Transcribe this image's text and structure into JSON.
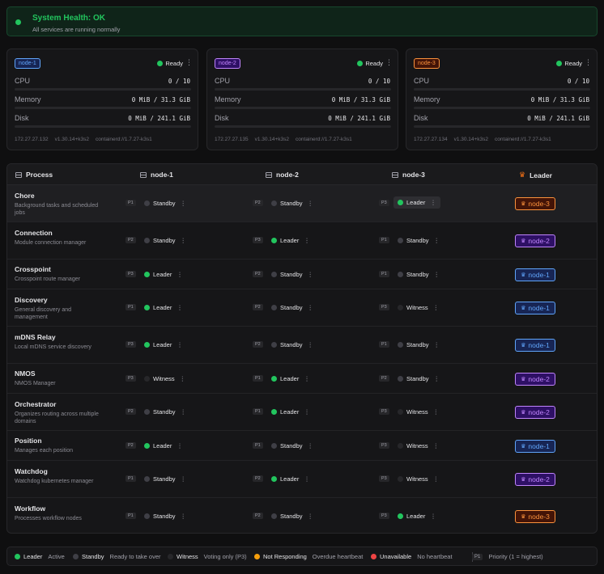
{
  "health": {
    "title": "System Health: OK",
    "subtitle": "All services are running normally"
  },
  "nodes": [
    {
      "name": "node-1",
      "status": "Ready",
      "cpu_label": "CPU",
      "cpu": "0 / 10",
      "mem_label": "Memory",
      "mem": "0 MiB / 31.3 GiB",
      "disk_label": "Disk",
      "disk": "0 MiB / 241.1 GiB",
      "ip": "172.27.27.132",
      "version": "v1.30.14+k3s2",
      "runtime": "containerd://1.7.27-k3s1",
      "color": "#60a5fa"
    },
    {
      "name": "node-2",
      "status": "Ready",
      "cpu_label": "CPU",
      "cpu": "0 / 10",
      "mem_label": "Memory",
      "mem": "0 MiB / 31.3 GiB",
      "disk_label": "Disk",
      "disk": "0 MiB / 241.1 GiB",
      "ip": "172.27.27.135",
      "version": "v1.30.14+k3s2",
      "runtime": "containerd://1.7.27-k3s1",
      "color": "#c084fc"
    },
    {
      "name": "node-3",
      "status": "Ready",
      "cpu_label": "CPU",
      "cpu": "0 / 10",
      "mem_label": "Memory",
      "mem": "0 MiB / 31.3 GiB",
      "disk_label": "Disk",
      "disk": "0 MiB / 241.1 GiB",
      "ip": "172.27.27.134",
      "version": "v1.30.14+k3s2",
      "runtime": "containerd://1.7.27-k3s1",
      "color": "#fb923c"
    }
  ],
  "table": {
    "headers": {
      "process": "Process",
      "node1": "node-1",
      "node2": "node-2",
      "node3": "node-3",
      "leader": "Leader"
    },
    "rows": [
      {
        "name": "Chore",
        "desc": "Background tasks and scheduled jobs",
        "cells": [
          {
            "p": "P1",
            "role": "Standby"
          },
          {
            "p": "P2",
            "role": "Standby"
          },
          {
            "p": "P3",
            "role": "Leader"
          }
        ],
        "leader": "node-3"
      },
      {
        "name": "Connection",
        "desc": "Module connection manager",
        "cells": [
          {
            "p": "P2",
            "role": "Standby"
          },
          {
            "p": "P3",
            "role": "Leader"
          },
          {
            "p": "P1",
            "role": "Standby"
          }
        ],
        "leader": "node-2"
      },
      {
        "name": "Crosspoint",
        "desc": "Crosspoint route manager",
        "cells": [
          {
            "p": "P3",
            "role": "Leader"
          },
          {
            "p": "P2",
            "role": "Standby"
          },
          {
            "p": "P1",
            "role": "Standby"
          }
        ],
        "leader": "node-1"
      },
      {
        "name": "Discovery",
        "desc": "General discovery and management",
        "cells": [
          {
            "p": "P1",
            "role": "Leader"
          },
          {
            "p": "P2",
            "role": "Standby"
          },
          {
            "p": "P3",
            "role": "Witness"
          }
        ],
        "leader": "node-1"
      },
      {
        "name": "mDNS Relay",
        "desc": "Local mDNS service discovery",
        "cells": [
          {
            "p": "P3",
            "role": "Leader"
          },
          {
            "p": "P2",
            "role": "Standby"
          },
          {
            "p": "P1",
            "role": "Standby"
          }
        ],
        "leader": "node-1"
      },
      {
        "name": "NMOS",
        "desc": "NMOS Manager",
        "cells": [
          {
            "p": "P3",
            "role": "Witness"
          },
          {
            "p": "P1",
            "role": "Leader"
          },
          {
            "p": "P2",
            "role": "Standby"
          }
        ],
        "leader": "node-2"
      },
      {
        "name": "Orchestrator",
        "desc": "Organizes routing across multiple domains",
        "cells": [
          {
            "p": "P2",
            "role": "Standby"
          },
          {
            "p": "P1",
            "role": "Leader"
          },
          {
            "p": "P3",
            "role": "Witness"
          }
        ],
        "leader": "node-2"
      },
      {
        "name": "Position",
        "desc": "Manages each position",
        "cells": [
          {
            "p": "P2",
            "role": "Leader"
          },
          {
            "p": "P1",
            "role": "Standby"
          },
          {
            "p": "P3",
            "role": "Witness"
          }
        ],
        "leader": "node-1"
      },
      {
        "name": "Watchdog",
        "desc": "Watchdog kubernetes manager",
        "cells": [
          {
            "p": "P1",
            "role": "Standby"
          },
          {
            "p": "P2",
            "role": "Leader"
          },
          {
            "p": "P3",
            "role": "Witness"
          }
        ],
        "leader": "node-2"
      },
      {
        "name": "Workflow",
        "desc": "Processes workflow nodes",
        "cells": [
          {
            "p": "P1",
            "role": "Standby"
          },
          {
            "p": "P2",
            "role": "Standby"
          },
          {
            "p": "P3",
            "role": "Leader"
          }
        ],
        "leader": "node-3"
      }
    ]
  },
  "legend": {
    "leader": "Leader",
    "leader_desc": "Active",
    "standby": "Standby",
    "standby_desc": "Ready to take over",
    "witness": "Witness",
    "witness_desc": "Voting only (P3)",
    "notresp": "Not Responding",
    "notresp_desc": "Overdue heartbeat",
    "unavail": "Unavailable",
    "unavail_desc": "No heartbeat",
    "prio_badge": "P1",
    "prio_desc": "Priority (1 = highest)"
  },
  "colors": {
    "ok": "#22c55e",
    "standby": "#3f3f46",
    "witness": "#27272a",
    "not_responding": "#f59e0b",
    "unavailable": "#ef4444",
    "node-1": "#60a5fa",
    "node-2": "#c084fc",
    "node-3": "#fb923c"
  }
}
